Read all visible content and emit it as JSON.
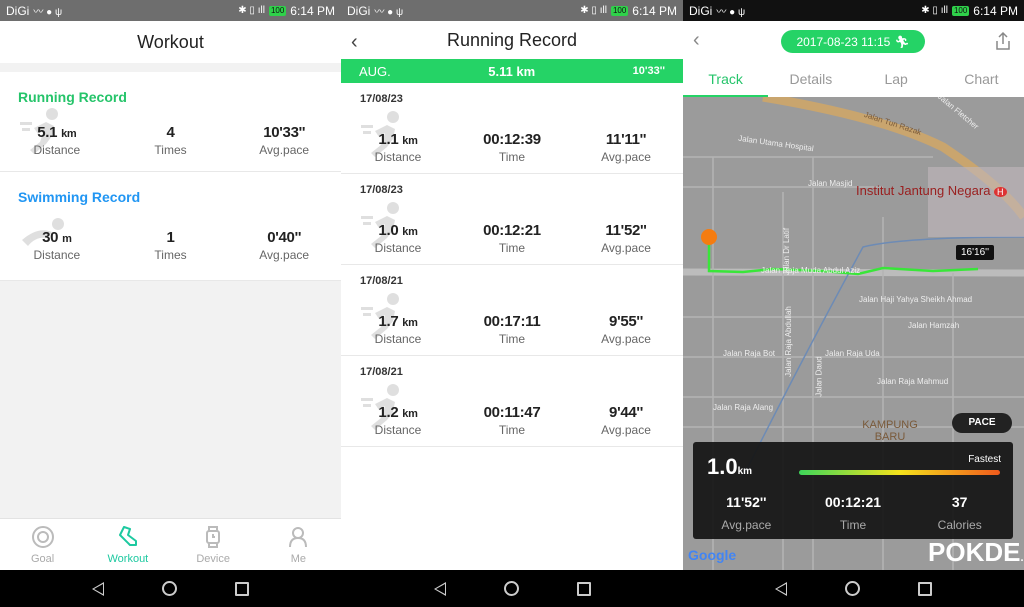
{
  "status_bar": {
    "carrier": "DiGi",
    "battery": "100",
    "time": "6:14 PM"
  },
  "workout": {
    "title": "Workout",
    "running": {
      "title": "Running Record",
      "color": "#25c46a",
      "distance": "5.1",
      "distance_unit": "km",
      "distance_label": "Distance",
      "times": "4",
      "times_label": "Times",
      "pace": "10'33''",
      "pace_label": "Avg.pace"
    },
    "swimming": {
      "title": "Swimming Record",
      "color": "#2196f3",
      "distance": "30",
      "distance_unit": "m",
      "distance_label": "Distance",
      "times": "1",
      "times_label": "Times",
      "pace": "0'40''",
      "pace_label": "Avg.pace"
    },
    "tabs": [
      {
        "label": "Goal",
        "icon": "target-icon"
      },
      {
        "label": "Workout",
        "icon": "shoe-icon",
        "active": true
      },
      {
        "label": "Device",
        "icon": "watch-icon"
      },
      {
        "label": "Me",
        "icon": "person-icon"
      }
    ]
  },
  "running_record": {
    "title": "Running Record",
    "month": {
      "label": "AUG.",
      "distance": "5.11 km",
      "pace": "10'33''"
    },
    "labels": {
      "distance": "Distance",
      "time": "Time",
      "pace": "Avg.pace"
    },
    "records": [
      {
        "date": "17/08/23",
        "distance": "1.1",
        "unit": "km",
        "time": "00:12:39",
        "pace": "11'11''"
      },
      {
        "date": "17/08/23",
        "distance": "1.0",
        "unit": "km",
        "time": "00:12:21",
        "pace": "11'52''"
      },
      {
        "date": "17/08/21",
        "distance": "1.7",
        "unit": "km",
        "time": "00:17:11",
        "pace": "9'55''"
      },
      {
        "date": "17/08/21",
        "distance": "1.2",
        "unit": "km",
        "time": "00:11:47",
        "pace": "9'44''"
      }
    ]
  },
  "track": {
    "datetime": "2017-08-23 11:15",
    "tabs": [
      "Track",
      "Details",
      "Lap",
      "Chart"
    ],
    "active_tab": "Track",
    "map_labels": [
      "Jalan Tun Razak",
      "Jalan Fletcher",
      "Jalan Utama Hospital",
      "Jalan Masjid",
      "Jalan Dr Latif",
      "Jalan Raja Muda Abdul Aziz",
      "Jalan Haji Yahya Sheikh Ahmad",
      "Jalan Hamzah",
      "Jalan Raja Abdullah",
      "Jalan Raja Bot",
      "Jalan Raja Uda",
      "Jalan Daud",
      "Jalan Raja Mahmud",
      "Jalan Raja Alang",
      "KAMPUNG BARU"
    ],
    "poi": "Institut Jantung Negara",
    "tooltip": "16'16''",
    "pace_button": "PACE",
    "summary": {
      "distance": "1.0",
      "unit": "km",
      "fastest_label": "Fastest",
      "pace": "11'52''",
      "pace_label": "Avg.pace",
      "time": "00:12:21",
      "time_label": "Time",
      "calories": "37",
      "calories_label": "Calories"
    },
    "google_logo": "Google",
    "watermark": "POKDE",
    "watermark_suffix": ".NET"
  }
}
